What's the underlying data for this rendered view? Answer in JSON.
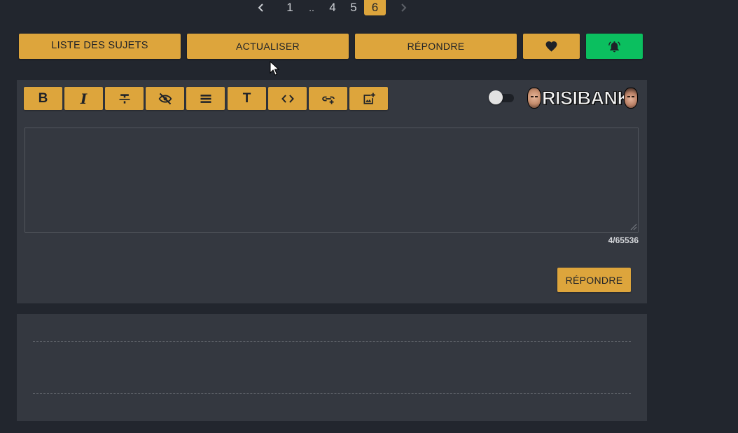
{
  "pagination": {
    "pages": [
      "1",
      "..",
      "4",
      "5",
      "6"
    ],
    "current": "6"
  },
  "topbar": {
    "liste_label": "LISTE DES SUJETS",
    "actualiser_label": "ACTUALISER",
    "repondre_label": "RÉPONDRE"
  },
  "editor": {
    "tools": {
      "bold": "B",
      "italic": "I",
      "title": "T"
    },
    "logo_text": "RISIBANK",
    "textarea_value": "",
    "counter": "4/65536",
    "submit_label": "RÉPONDRE"
  },
  "colors": {
    "accent": "#dda53c",
    "notify": "#0bbf5f",
    "background": "#22262e",
    "panel": "#343840"
  },
  "icons": {
    "prev": "chevron-left-icon",
    "next": "chevron-right-icon",
    "favorite": "heart-icon",
    "notify": "bell-ring-icon",
    "strike": "strikethrough-icon",
    "spoiler": "eye-off-icon",
    "quote": "quote-lines-icon",
    "code": "code-icon",
    "link": "link-add-icon",
    "image": "image-add-icon"
  }
}
